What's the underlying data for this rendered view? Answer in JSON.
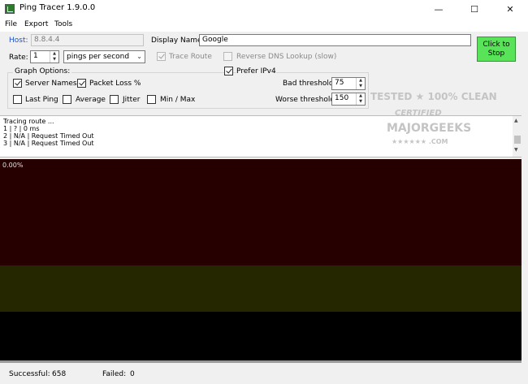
{
  "window": {
    "title": "Ping Tracer 1.9.0.0",
    "minimize_glyph": "—",
    "maximize_glyph": "☐",
    "close_glyph": "✕"
  },
  "menu": [
    "File",
    "Export",
    "Tools"
  ],
  "host": {
    "label": "Host:",
    "value": "8.8.4.4"
  },
  "display_name": {
    "label": "Display Name:",
    "value": "Google"
  },
  "rate": {
    "label": "Rate:",
    "value": "1",
    "unit": "pings per second"
  },
  "trace_route": {
    "label": "Trace Route",
    "checked": true
  },
  "reverse_dns": {
    "label": "Reverse DNS Lookup (slow)",
    "checked": false
  },
  "stop_button": {
    "line1": "Click to",
    "line2": "Stop",
    "color": "#59e359"
  },
  "graph_options": {
    "title": "Graph Options:",
    "server_names": {
      "label": "Server Names",
      "checked": true
    },
    "packet_loss": {
      "label": "Packet Loss %",
      "checked": true
    },
    "prefer_ipv4": {
      "label": "Prefer IPv4",
      "checked": true
    },
    "last_ping": {
      "label": "Last Ping",
      "checked": false
    },
    "average": {
      "label": "Average",
      "checked": false
    },
    "jitter": {
      "label": "Jitter",
      "checked": false
    },
    "min_max": {
      "label": "Min / Max",
      "checked": false
    }
  },
  "thresholds": {
    "bad": {
      "label": "Bad threshold:",
      "value": "75"
    },
    "worse": {
      "label": "Worse threshold:",
      "value": "150"
    }
  },
  "watermark": {
    "line1": "TESTED ★ 100% CLEAN",
    "line2": "CERTIFIED",
    "line3": "MAJORGEEKS",
    "line4": "★★★★★★ .COM"
  },
  "log": [
    "Tracing route ...",
    "1 |                       ? | 0 ms",
    "2 | N/A | Request Timed Out",
    "3 | N/A | Request Timed Out"
  ],
  "graph": {
    "packet_loss_label": "0.00%",
    "colors": {
      "worse_band": "#260000",
      "bad_band": "#252700",
      "background": "#000000"
    }
  },
  "status": {
    "successful_label": "Successful:",
    "successful_value": "658",
    "failed_label": "Failed:",
    "failed_value": "0"
  }
}
